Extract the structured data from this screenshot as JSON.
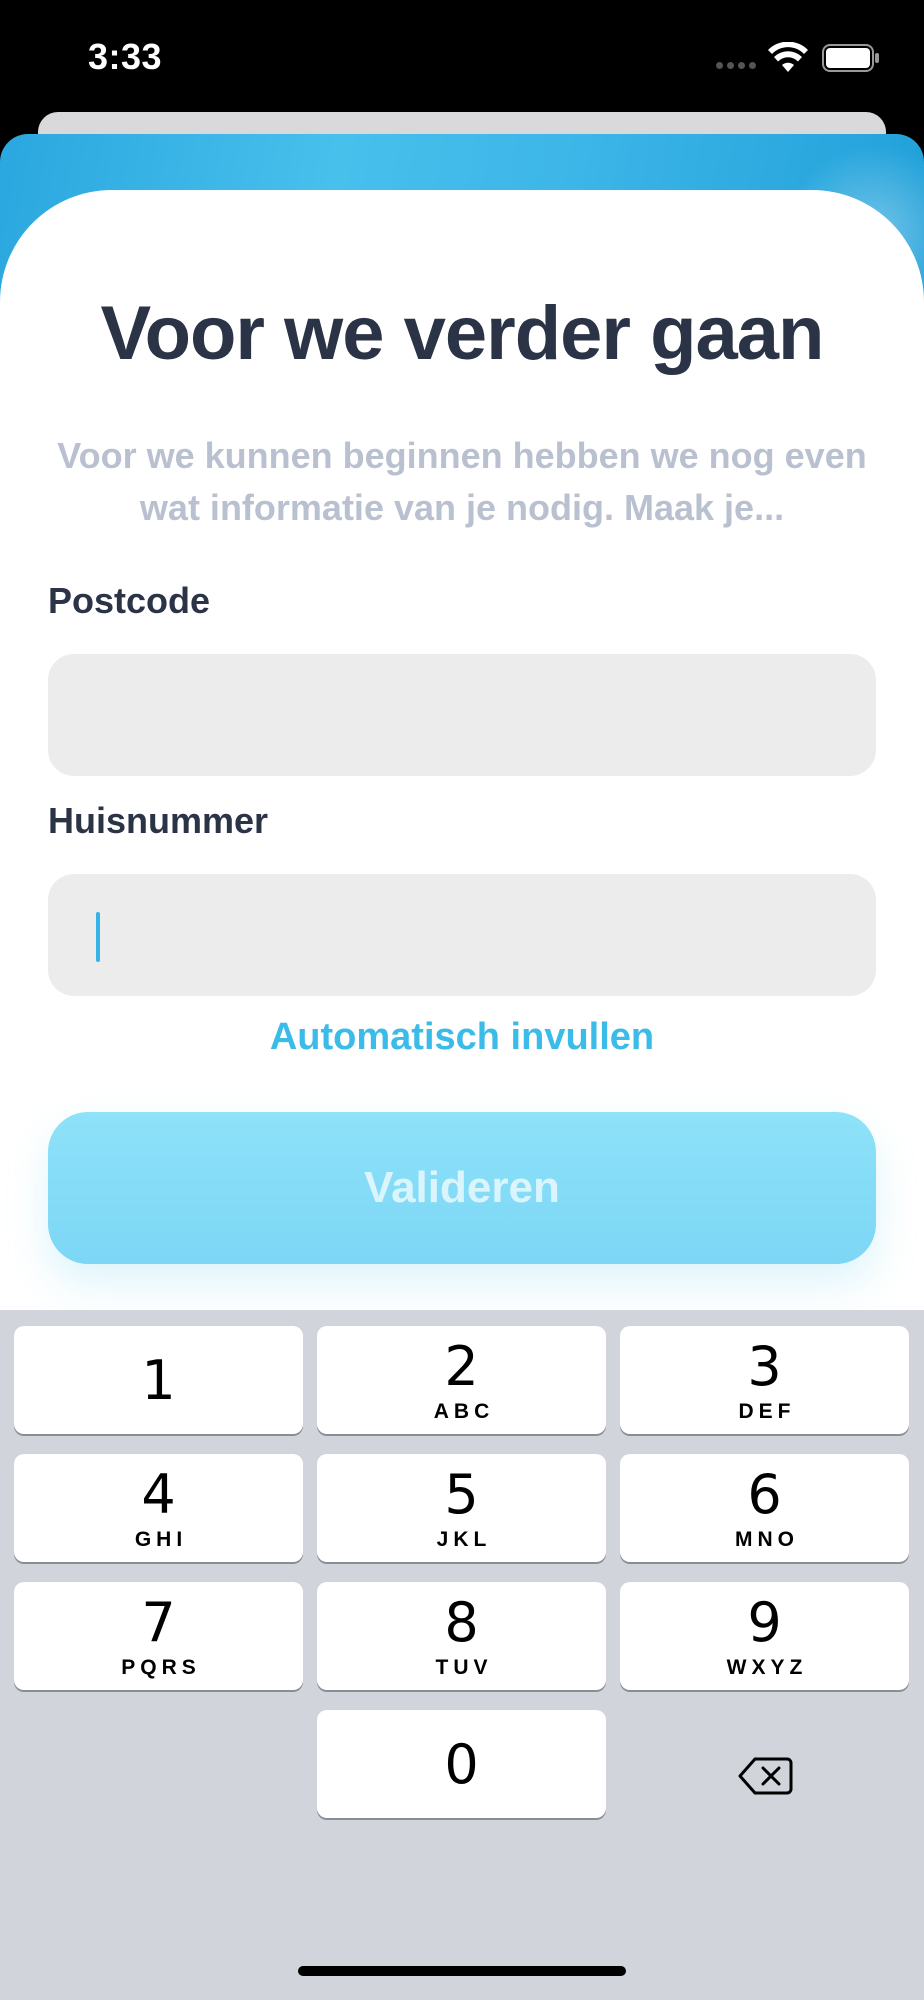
{
  "status_bar": {
    "time": "3:33",
    "icons": [
      "cellular-dots-icon",
      "wifi-icon",
      "battery-icon"
    ]
  },
  "form": {
    "title": "Voor we verder gaan",
    "subtitle": "Voor we kunnen beginnen hebben we nog even wat informatie van je nodig. Maak je...",
    "postcode_label": "Postcode",
    "postcode_value": "",
    "huisnummer_label": "Huisnummer",
    "huisnummer_value": "",
    "autofill_label": "Automatisch invullen",
    "validate_label": "Valideren"
  },
  "keyboard": {
    "keys": [
      {
        "num": "1",
        "letters": ""
      },
      {
        "num": "2",
        "letters": "ABC"
      },
      {
        "num": "3",
        "letters": "DEF"
      },
      {
        "num": "4",
        "letters": "GHI"
      },
      {
        "num": "5",
        "letters": "JKL"
      },
      {
        "num": "6",
        "letters": "MNO"
      },
      {
        "num": "7",
        "letters": "PQRS"
      },
      {
        "num": "8",
        "letters": "TUV"
      },
      {
        "num": "9",
        "letters": "WXYZ"
      },
      {
        "num": "0",
        "letters": ""
      }
    ],
    "delete_icon": "backspace-icon"
  },
  "colors": {
    "title": "#2b3346",
    "subtitle": "#b9c0cf",
    "accent": "#3bbbe8",
    "button": "#7cd6f5",
    "input_bg": "#ececec",
    "keyboard_bg": "#d1d4da"
  }
}
